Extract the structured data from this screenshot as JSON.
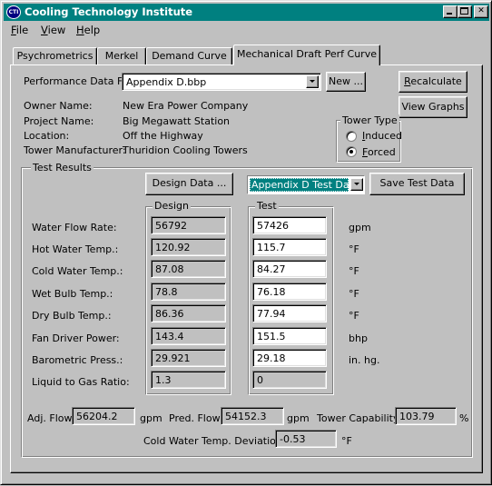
{
  "window": {
    "title": "Cooling Technology Institute",
    "icon_text": "CTI"
  },
  "menu": [
    {
      "ul": "F",
      "rest": "ile"
    },
    {
      "ul": "V",
      "rest": "iew"
    },
    {
      "ul": "H",
      "rest": "elp"
    }
  ],
  "tabs": [
    "Psychrometrics",
    "Merkel",
    "Demand Curve",
    "Mechanical Draft Perf Curve"
  ],
  "perf_file": {
    "label": "Performance Data File:",
    "value": "Appendix D.bbp",
    "new_label": "New ..."
  },
  "buttons": {
    "recalc_ul": "R",
    "recalc_rest": "ecalculate",
    "view_graphs": "View Graphs",
    "design_data": "Design Data ...",
    "save_test": "Save Test Data"
  },
  "info": [
    {
      "label": "Owner Name:",
      "value": "New Era Power Company"
    },
    {
      "label": "Project Name:",
      "value": "Big Megawatt Station"
    },
    {
      "label": "Location:",
      "value": "Off the Highway"
    },
    {
      "label": "Tower Manufacturer:",
      "value": "Thuridion Cooling Towers"
    }
  ],
  "tower_type": {
    "title": "Tower Type",
    "options": [
      {
        "ul": "I",
        "rest": "nduced",
        "checked": false
      },
      {
        "ul": "F",
        "rest": "orced",
        "checked": true
      }
    ]
  },
  "test_results": {
    "title": "Test Results",
    "data_select": "Appendix D Test Data",
    "design_title": "Design",
    "test_title": "Test",
    "rows": [
      {
        "label": "Water Flow Rate:",
        "design": "56792",
        "test": "57426",
        "unit": "gpm"
      },
      {
        "label": "Hot Water Temp.:",
        "design": "120.92",
        "test": "115.7",
        "unit": "°F"
      },
      {
        "label": "Cold Water Temp.:",
        "design": "87.08",
        "test": "84.27",
        "unit": "°F"
      },
      {
        "label": "Wet Bulb Temp.:",
        "design": "78.8",
        "test": "76.18",
        "unit": "°F"
      },
      {
        "label": "Dry Bulb Temp.:",
        "design": "86.36",
        "test": "77.94",
        "unit": "°F"
      },
      {
        "label": "Fan Driver Power:",
        "design": "143.4",
        "test": "151.5",
        "unit": "bhp"
      },
      {
        "label": "Barometric Press.:",
        "design": "29.921",
        "test": "29.18",
        "unit": "in. hg."
      },
      {
        "label": "Liquid to Gas Ratio:",
        "design": "1.3",
        "test": "0",
        "unit": ""
      }
    ]
  },
  "results": {
    "adj_flow_label": "Adj. Flow:",
    "adj_flow": "56204.2",
    "adj_flow_unit": "gpm",
    "pred_flow_label": "Pred. Flow:",
    "pred_flow": "54152.3",
    "pred_flow_unit": "gpm",
    "capability_label": "Tower Capability:",
    "capability": "103.79",
    "capability_unit": "%",
    "deviation_label": "Cold Water Temp. Deviation:",
    "deviation": "-0.53",
    "deviation_unit": "°F"
  }
}
